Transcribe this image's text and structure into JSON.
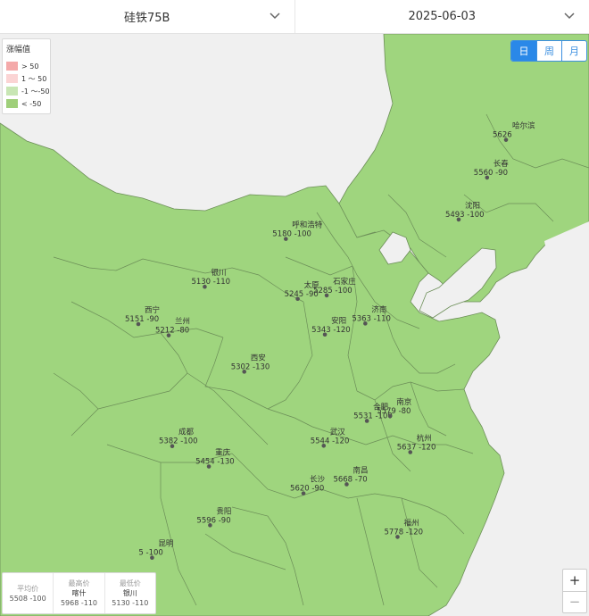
{
  "header": {
    "product": "硅铁75B",
    "date": "2025-06-03"
  },
  "legend": {
    "title": "涨幅值",
    "items": [
      {
        "label": "> 50",
        "color": "#f4a9a9"
      },
      {
        "label": "1 ～ 50",
        "color": "#fbd4d4"
      },
      {
        "label": "-1 ～-50",
        "color": "#c8e6b4"
      },
      {
        "label": "< -50",
        "color": "#9fcf7a"
      }
    ]
  },
  "period": {
    "day": "日",
    "week": "周",
    "month": "月",
    "active": "day"
  },
  "colors": {
    "land": "#9fd57e",
    "border": "#6c8e58",
    "sea": "#f0f0f0",
    "dot": "#555555"
  },
  "cities": [
    {
      "name": "哈尔滨",
      "value": "5626",
      "lat": 45.75,
      "lon": 126.63
    },
    {
      "name": "长春",
      "value": "5560 -90",
      "lat": 43.88,
      "lon": 125.35
    },
    {
      "name": "沈阳",
      "value": "5493 -100",
      "lat": 41.8,
      "lon": 123.43
    },
    {
      "name": "呼和浩特",
      "value": "5180 -100",
      "lat": 40.84,
      "lon": 111.75
    },
    {
      "name": "石家庄",
      "value": "5285 -100",
      "lat": 38.04,
      "lon": 114.51
    },
    {
      "name": "太原",
      "value": "5245 -90",
      "lat": 37.87,
      "lon": 112.55
    },
    {
      "name": "银川",
      "value": "5130 -110",
      "lat": 38.47,
      "lon": 106.27
    },
    {
      "name": "济南",
      "value": "5363 -110",
      "lat": 36.65,
      "lon": 117.12
    },
    {
      "name": "安阳",
      "value": "5343 -120",
      "lat": 36.1,
      "lon": 114.39
    },
    {
      "name": "西宁",
      "value": "5151 -90",
      "lat": 36.62,
      "lon": 101.78
    },
    {
      "name": "兰州",
      "value": "5212 -80",
      "lat": 36.06,
      "lon": 103.83
    },
    {
      "name": "西安",
      "value": "5302 -130",
      "lat": 34.26,
      "lon": 108.94
    },
    {
      "name": "合肥",
      "value": "5531 -100",
      "lat": 31.82,
      "lon": 117.23
    },
    {
      "name": "南京",
      "value": "5579 -80",
      "lat": 32.06,
      "lon": 118.8
    },
    {
      "name": "成都",
      "value": "5382 -100",
      "lat": 30.57,
      "lon": 104.07
    },
    {
      "name": "武汉",
      "value": "5544 -120",
      "lat": 30.59,
      "lon": 114.31
    },
    {
      "name": "杭州",
      "value": "5637 -120",
      "lat": 30.27,
      "lon": 120.16
    },
    {
      "name": "重庆",
      "value": "5454 -130",
      "lat": 29.56,
      "lon": 106.55
    },
    {
      "name": "长沙",
      "value": "5620 -90",
      "lat": 28.23,
      "lon": 112.94
    },
    {
      "name": "南昌",
      "value": "5668 -70",
      "lat": 28.68,
      "lon": 115.86
    },
    {
      "name": "贵阳",
      "value": "5596 -90",
      "lat": 26.65,
      "lon": 106.63
    },
    {
      "name": "福州",
      "value": "5778 -120",
      "lat": 26.07,
      "lon": 119.3
    },
    {
      "name": "昆明",
      "value": "5 -100",
      "lat": 25.04,
      "lon": 102.71
    }
  ],
  "stats": {
    "avg_label": "平均价",
    "avg_value": "5508 -100",
    "max_label": "最高价",
    "max_city": "喀什",
    "max_value": "5968 -110",
    "min_label": "最低价",
    "min_city": "银川",
    "min_value": "5130 -110"
  },
  "zoom": {
    "in": "+",
    "out": "−"
  }
}
